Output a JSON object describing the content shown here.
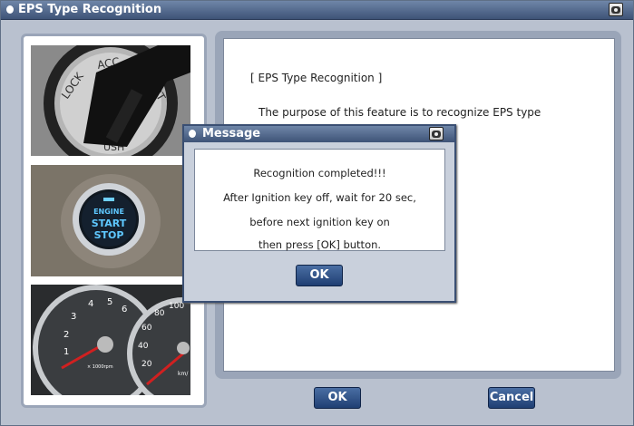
{
  "window": {
    "title": "EPS Type Recognition"
  },
  "content": {
    "heading": "[ EPS Type Recognition ]",
    "description": "The purpose of this feature is to recognize EPS type"
  },
  "images": {
    "ignition_key_lock": [
      "LOCK",
      "ACC",
      "ART",
      "USH"
    ],
    "start_button": [
      "ENGINE",
      "START",
      "STOP"
    ],
    "gauge": {
      "tach_numbers": [
        "1",
        "2",
        "3",
        "4",
        "5",
        "6"
      ],
      "tach_unit": "× 1000rpm",
      "speed_numbers": [
        "20",
        "40",
        "60",
        "80",
        "100"
      ],
      "speed_unit": "km/"
    }
  },
  "dialog": {
    "title": "Message",
    "lines": [
      "Recognition completed!!!",
      "After Ignition key off, wait for 20 sec,",
      "before next ignition key on",
      "then press [OK] button."
    ],
    "ok_label": "OK"
  },
  "footer": {
    "ok_label": "OK",
    "cancel_label": "Cancel"
  }
}
